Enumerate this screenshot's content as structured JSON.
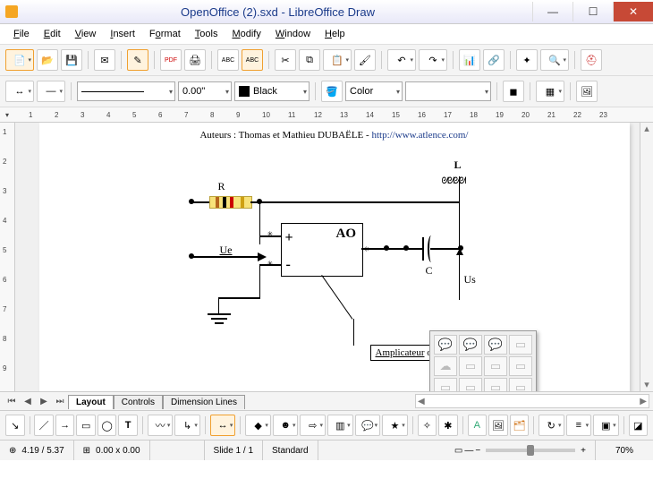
{
  "window": {
    "title": "OpenOffice (2).sxd - LibreOffice Draw"
  },
  "menu": {
    "file": "File",
    "edit": "Edit",
    "view": "View",
    "insert": "Insert",
    "format": "Format",
    "tools": "Tools",
    "modify": "Modify",
    "window": "Window",
    "help": "Help"
  },
  "linebar": {
    "width": "0.00\"",
    "color_name": "Black",
    "fill_label": "Color"
  },
  "hruler": [
    "1",
    "2",
    "3",
    "4",
    "5",
    "6",
    "7",
    "8",
    "9",
    "10",
    "11",
    "12",
    "13",
    "14",
    "15",
    "16",
    "17",
    "18",
    "19",
    "20",
    "21",
    "22",
    "23"
  ],
  "vruler": [
    "1",
    "2",
    "3",
    "4",
    "5",
    "6",
    "7",
    "8",
    "9"
  ],
  "page": {
    "credit_prefix": "Auteurs : Thomas et Mathieu DUBAËLE - ",
    "credit_link": "http://www.atlence.com/"
  },
  "circuit": {
    "R": "R",
    "L": "L",
    "C": "C",
    "Ue": "Ue",
    "Us": "Us",
    "AO": "AO",
    "plus": "+",
    "minus": "-",
    "callout_a": "Amplicateur",
    "callout_b": " opérationnel"
  },
  "tabs": {
    "layout": "Layout",
    "controls": "Controls",
    "dimension": "Dimension Lines"
  },
  "status": {
    "pos_icon": "⊕",
    "pos": "4.19 / 5.37",
    "size_icon": "⊞",
    "size": "0.00 x 0.00",
    "slide": "Slide 1 / 1",
    "mode": "Standard",
    "zoom": "70%"
  }
}
